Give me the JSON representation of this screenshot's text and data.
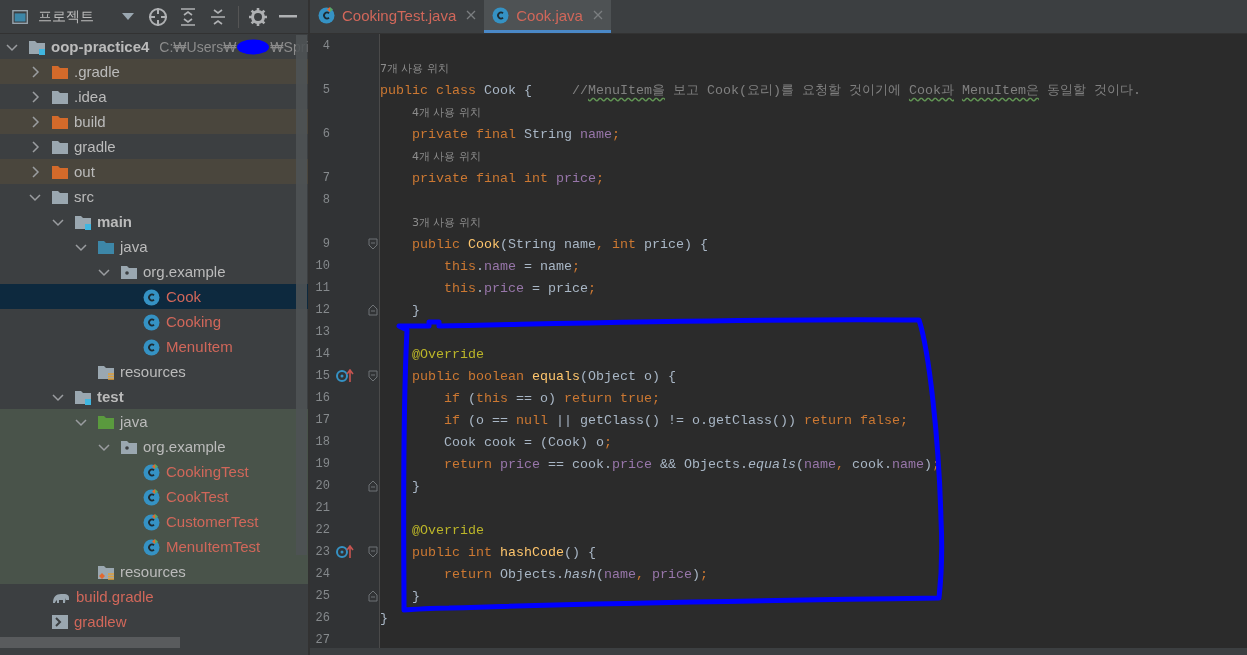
{
  "project_panel": {
    "title": "프로젝트",
    "tree": [
      {
        "label": "oop-practice4",
        "kind": "module",
        "path_start": "C:₩Users₩",
        "path_end": "₩Spri",
        "expanded": true,
        "selected": false,
        "excluded": false,
        "test": false,
        "untracked": false,
        "children": [
          {
            "label": ".gradle",
            "kind": "excluded-folder",
            "expanded": false,
            "selected": false,
            "excluded": true,
            "test": false,
            "untracked": false
          },
          {
            "label": ".idea",
            "kind": "folder",
            "expanded": false,
            "selected": false,
            "excluded": false,
            "test": false,
            "untracked": false
          },
          {
            "label": "build",
            "kind": "excluded-folder",
            "expanded": false,
            "selected": false,
            "excluded": true,
            "test": false,
            "untracked": false
          },
          {
            "label": "gradle",
            "kind": "folder",
            "expanded": false,
            "selected": false,
            "excluded": false,
            "test": false,
            "untracked": false
          },
          {
            "label": "out",
            "kind": "excluded-folder",
            "expanded": false,
            "selected": false,
            "excluded": true,
            "test": false,
            "untracked": false
          },
          {
            "label": "src",
            "kind": "folder",
            "expanded": true,
            "selected": false,
            "excluded": false,
            "test": false,
            "untracked": false,
            "children": [
              {
                "label": "main",
                "kind": "module",
                "expanded": true,
                "selected": false,
                "excluded": false,
                "test": false,
                "untracked": false,
                "children": [
                  {
                    "label": "java",
                    "kind": "source-folder",
                    "expanded": true,
                    "selected": false,
                    "excluded": false,
                    "test": false,
                    "untracked": false,
                    "children": [
                      {
                        "label": "org.example",
                        "kind": "package",
                        "expanded": true,
                        "selected": false,
                        "excluded": false,
                        "test": false,
                        "untracked": false,
                        "children": [
                          {
                            "label": "Cook",
                            "kind": "class",
                            "selected": true,
                            "excluded": false,
                            "test": false,
                            "untracked": true
                          },
                          {
                            "label": "Cooking",
                            "kind": "class",
                            "selected": false,
                            "excluded": false,
                            "test": false,
                            "untracked": true
                          },
                          {
                            "label": "MenuItem",
                            "kind": "class",
                            "selected": false,
                            "excluded": false,
                            "test": false,
                            "untracked": true
                          }
                        ]
                      }
                    ]
                  },
                  {
                    "label": "resources",
                    "kind": "resources",
                    "selected": false,
                    "excluded": false,
                    "test": false,
                    "untracked": false
                  }
                ]
              },
              {
                "label": "test",
                "kind": "module",
                "expanded": true,
                "selected": false,
                "excluded": false,
                "test": false,
                "untracked": false,
                "children": [
                  {
                    "label": "java",
                    "kind": "test-folder",
                    "expanded": true,
                    "selected": false,
                    "excluded": false,
                    "test": true,
                    "untracked": false,
                    "children": [
                      {
                        "label": "org.example",
                        "kind": "package",
                        "expanded": true,
                        "selected": false,
                        "excluded": false,
                        "test": true,
                        "untracked": false,
                        "children": [
                          {
                            "label": "CookingTest",
                            "kind": "test-class",
                            "selected": false,
                            "excluded": false,
                            "test": true,
                            "untracked": true
                          },
                          {
                            "label": "CookTest",
                            "kind": "test-class",
                            "selected": false,
                            "excluded": false,
                            "test": true,
                            "untracked": true
                          },
                          {
                            "label": "CustomerTest",
                            "kind": "test-class",
                            "selected": false,
                            "excluded": false,
                            "test": true,
                            "untracked": true
                          },
                          {
                            "label": "MenuItemTest",
                            "kind": "test-class",
                            "selected": false,
                            "excluded": false,
                            "test": true,
                            "untracked": true
                          }
                        ]
                      }
                    ]
                  },
                  {
                    "label": "resources",
                    "kind": "test-resources",
                    "selected": false,
                    "excluded": false,
                    "test": true,
                    "untracked": false
                  }
                ]
              }
            ]
          },
          {
            "label": "build.gradle",
            "kind": "gradle-file",
            "selected": false,
            "excluded": false,
            "test": false,
            "untracked": true
          },
          {
            "label": "gradlew",
            "kind": "script-file",
            "selected": false,
            "excluded": false,
            "test": false,
            "untracked": true
          }
        ]
      }
    ]
  },
  "editor": {
    "tabs": [
      {
        "label": "CookingTest.java",
        "kind": "test-class",
        "selected": false,
        "untracked": true
      },
      {
        "label": "Cook.java",
        "kind": "class",
        "selected": true,
        "untracked": true
      }
    ],
    "lines": [
      {
        "number": "4",
        "fold_start": false,
        "fold_end": false,
        "overrides": false
      },
      {
        "number": "5",
        "usages": "7개 사용 위치",
        "fold_start": false,
        "fold_end": false,
        "overrides": false,
        "tokens": [
          {
            "kind": "keyword",
            "text": "public class "
          },
          {
            "kind": "plain",
            "text": "Cook {     "
          },
          {
            "kind": "comment",
            "text": "//"
          },
          {
            "kind": "typo",
            "text": "MenuItem을"
          },
          {
            "kind": "comment",
            "text": " 보고 Cook(요리)를 요청할 것이기에 "
          },
          {
            "kind": "typo",
            "text": "Cook과"
          },
          {
            "kind": "typo",
            "text": " MenuItem은"
          },
          {
            "kind": "comment",
            "text": " 동일할 것이다."
          }
        ]
      },
      {
        "number": "6",
        "usages": "4개 사용 위치",
        "fold_start": false,
        "fold_end": false,
        "overrides": false,
        "tokens": [
          {
            "kind": "keyword",
            "text": "    private final "
          },
          {
            "kind": "plain",
            "text": "String "
          },
          {
            "kind": "field",
            "text": "name"
          },
          {
            "kind": "keyword",
            "text": ";"
          }
        ]
      },
      {
        "number": "7",
        "usages": "4개 사용 위치",
        "fold_start": false,
        "fold_end": false,
        "overrides": false,
        "tokens": [
          {
            "kind": "keyword",
            "text": "    private final int "
          },
          {
            "kind": "field",
            "text": "price"
          },
          {
            "kind": "keyword",
            "text": ";"
          }
        ]
      },
      {
        "number": "8",
        "fold_start": false,
        "fold_end": false,
        "overrides": false
      },
      {
        "number": "9",
        "usages": "3개 사용 위치",
        "fold_start": true,
        "fold_end": false,
        "overrides": false,
        "tokens": [
          {
            "kind": "keyword",
            "text": "    public "
          },
          {
            "kind": "method",
            "text": "Cook"
          },
          {
            "kind": "plain",
            "text": "(String name"
          },
          {
            "kind": "keyword",
            "text": ", int "
          },
          {
            "kind": "plain",
            "text": "price) {"
          }
        ]
      },
      {
        "number": "10",
        "fold_start": false,
        "fold_end": false,
        "overrides": false,
        "tokens": [
          {
            "kind": "keyword",
            "text": "        this"
          },
          {
            "kind": "plain",
            "text": "."
          },
          {
            "kind": "field",
            "text": "name"
          },
          {
            "kind": "plain",
            "text": " = name"
          },
          {
            "kind": "keyword",
            "text": ";"
          }
        ]
      },
      {
        "number": "11",
        "fold_start": false,
        "fold_end": false,
        "overrides": false,
        "tokens": [
          {
            "kind": "keyword",
            "text": "        this"
          },
          {
            "kind": "plain",
            "text": "."
          },
          {
            "kind": "field",
            "text": "price"
          },
          {
            "kind": "plain",
            "text": " = price"
          },
          {
            "kind": "keyword",
            "text": ";"
          }
        ]
      },
      {
        "number": "12",
        "fold_start": false,
        "fold_end": true,
        "overrides": false,
        "tokens": [
          {
            "kind": "plain",
            "text": "    }"
          }
        ]
      },
      {
        "number": "13",
        "fold_start": false,
        "fold_end": false,
        "overrides": false
      },
      {
        "number": "14",
        "fold_start": false,
        "fold_end": false,
        "overrides": false,
        "tokens": [
          {
            "kind": "annotation",
            "text": "    @Override"
          }
        ]
      },
      {
        "number": "15",
        "fold_start": true,
        "fold_end": false,
        "overrides": true,
        "tokens": [
          {
            "kind": "keyword",
            "text": "    public boolean "
          },
          {
            "kind": "method",
            "text": "equals"
          },
          {
            "kind": "plain",
            "text": "(Object o) {"
          }
        ]
      },
      {
        "number": "16",
        "fold_start": false,
        "fold_end": false,
        "overrides": false,
        "tokens": [
          {
            "kind": "keyword",
            "text": "        if "
          },
          {
            "kind": "plain",
            "text": "("
          },
          {
            "kind": "keyword",
            "text": "this"
          },
          {
            "kind": "plain",
            "text": " == o) "
          },
          {
            "kind": "keyword",
            "text": "return true;"
          }
        ]
      },
      {
        "number": "17",
        "fold_start": false,
        "fold_end": false,
        "overrides": false,
        "tokens": [
          {
            "kind": "keyword",
            "text": "        if "
          },
          {
            "kind": "plain",
            "text": "(o == "
          },
          {
            "kind": "keyword",
            "text": "null "
          },
          {
            "kind": "plain",
            "text": "|| getClass() != o.getClass()) "
          },
          {
            "kind": "keyword",
            "text": "return false;"
          }
        ]
      },
      {
        "number": "18",
        "fold_start": false,
        "fold_end": false,
        "overrides": false,
        "tokens": [
          {
            "kind": "plain",
            "text": "        Cook cook = (Cook) o"
          },
          {
            "kind": "keyword",
            "text": ";"
          }
        ]
      },
      {
        "number": "19",
        "fold_start": false,
        "fold_end": false,
        "overrides": false,
        "tokens": [
          {
            "kind": "keyword",
            "text": "        return "
          },
          {
            "kind": "field",
            "text": "price"
          },
          {
            "kind": "plain",
            "text": " == cook."
          },
          {
            "kind": "field",
            "text": "price"
          },
          {
            "kind": "plain",
            "text": " && Objects."
          },
          {
            "kind": "static",
            "text": "equals"
          },
          {
            "kind": "plain",
            "text": "("
          },
          {
            "kind": "field",
            "text": "name"
          },
          {
            "kind": "keyword",
            "text": ", "
          },
          {
            "kind": "plain",
            "text": "cook."
          },
          {
            "kind": "field",
            "text": "name"
          },
          {
            "kind": "plain",
            "text": ")"
          },
          {
            "kind": "keyword",
            "text": ";"
          }
        ]
      },
      {
        "number": "20",
        "fold_start": false,
        "fold_end": true,
        "overrides": false,
        "tokens": [
          {
            "kind": "plain",
            "text": "    }"
          }
        ]
      },
      {
        "number": "21",
        "fold_start": false,
        "fold_end": false,
        "overrides": false
      },
      {
        "number": "22",
        "fold_start": false,
        "fold_end": false,
        "overrides": false,
        "tokens": [
          {
            "kind": "annotation",
            "text": "    @Override"
          }
        ]
      },
      {
        "number": "23",
        "fold_start": true,
        "fold_end": false,
        "overrides": true,
        "tokens": [
          {
            "kind": "keyword",
            "text": "    public int "
          },
          {
            "kind": "method",
            "text": "hashCode"
          },
          {
            "kind": "plain",
            "text": "() {"
          }
        ]
      },
      {
        "number": "24",
        "fold_start": false,
        "fold_end": false,
        "overrides": false,
        "tokens": [
          {
            "kind": "keyword",
            "text": "        return "
          },
          {
            "kind": "plain",
            "text": "Objects."
          },
          {
            "kind": "static",
            "text": "hash"
          },
          {
            "kind": "plain",
            "text": "("
          },
          {
            "kind": "field",
            "text": "name"
          },
          {
            "kind": "keyword",
            "text": ", "
          },
          {
            "kind": "field",
            "text": "price"
          },
          {
            "kind": "plain",
            "text": ")"
          },
          {
            "kind": "keyword",
            "text": ";"
          }
        ]
      },
      {
        "number": "25",
        "fold_start": false,
        "fold_end": true,
        "overrides": false,
        "tokens": [
          {
            "kind": "plain",
            "text": "    }"
          }
        ]
      },
      {
        "number": "26",
        "fold_start": false,
        "fold_end": false,
        "overrides": false,
        "tokens": [
          {
            "kind": "plain",
            "text": "}"
          }
        ]
      },
      {
        "number": "27",
        "fold_start": false,
        "fold_end": false,
        "overrides": false
      }
    ]
  }
}
